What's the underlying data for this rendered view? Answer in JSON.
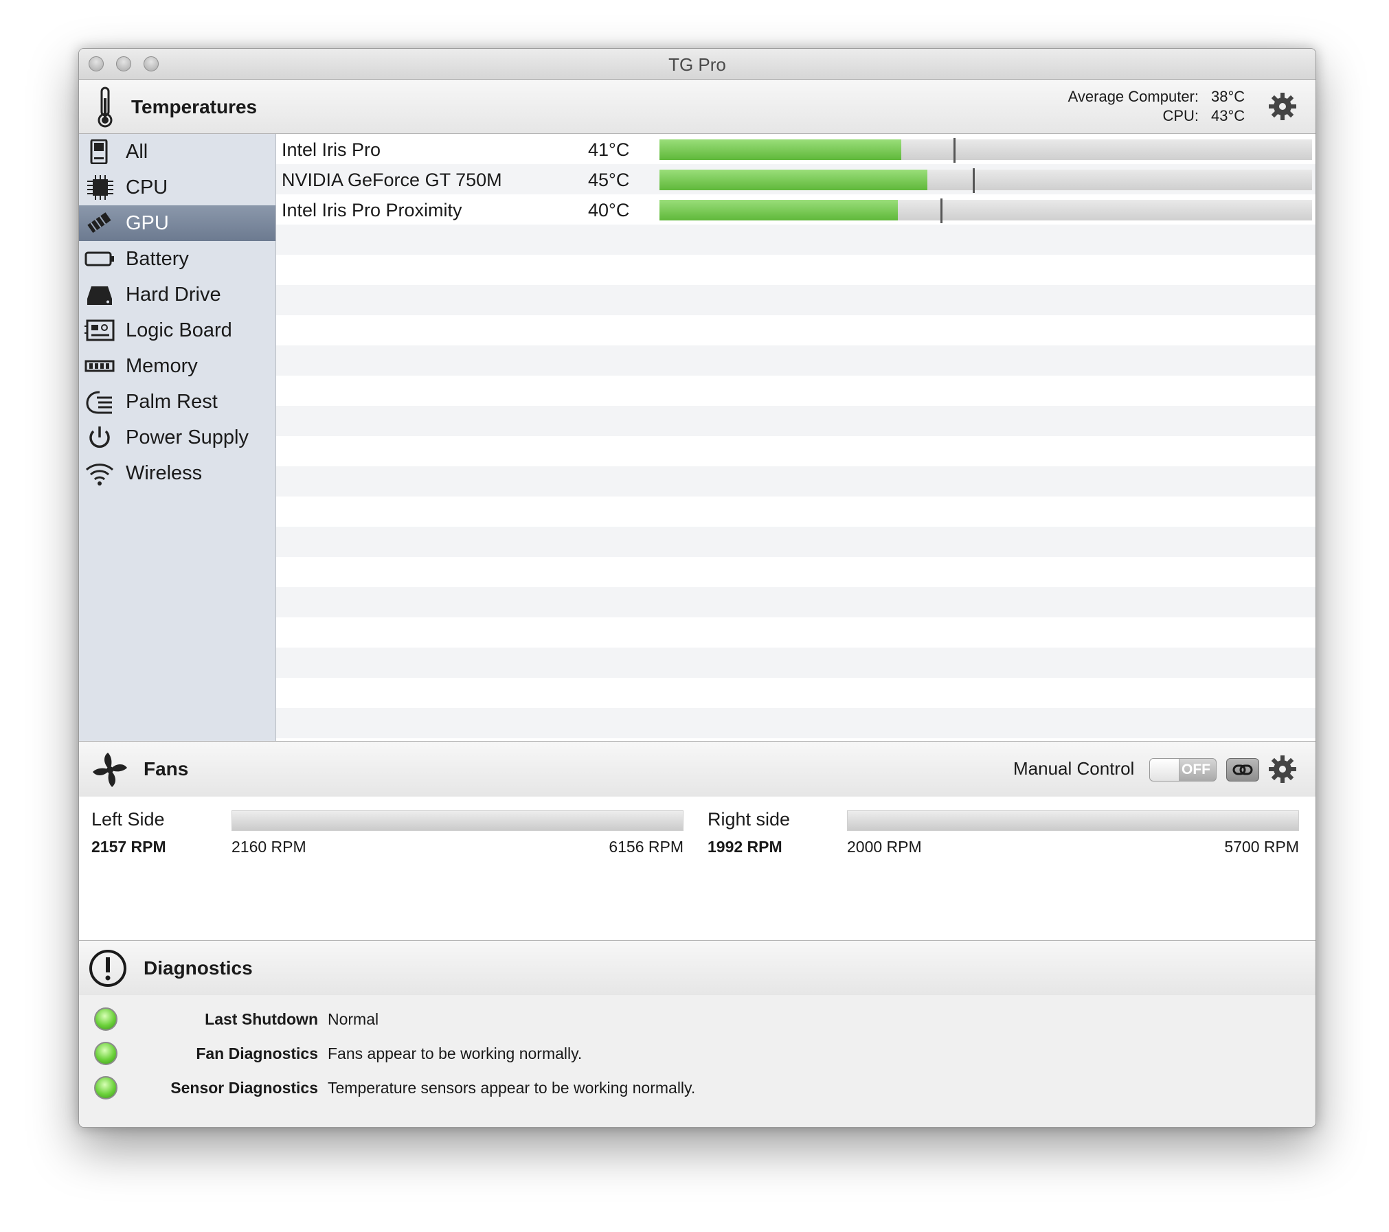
{
  "window": {
    "title": "TG Pro"
  },
  "temperatures": {
    "title": "Temperatures",
    "average_label": "Average Computer:",
    "average_value": "38°C",
    "cpu_label": "CPU:",
    "cpu_value": "43°C"
  },
  "sidebar": {
    "items": [
      {
        "label": "All",
        "icon": "computer-icon"
      },
      {
        "label": "CPU",
        "icon": "cpu-chip-icon"
      },
      {
        "label": "GPU",
        "icon": "gpu-card-icon",
        "selected": true
      },
      {
        "label": "Battery",
        "icon": "battery-icon"
      },
      {
        "label": "Hard Drive",
        "icon": "hard-drive-icon"
      },
      {
        "label": "Logic Board",
        "icon": "logic-board-icon"
      },
      {
        "label": "Memory",
        "icon": "memory-icon"
      },
      {
        "label": "Palm Rest",
        "icon": "palm-rest-icon"
      },
      {
        "label": "Power Supply",
        "icon": "power-icon"
      },
      {
        "label": "Wireless",
        "icon": "wifi-icon"
      }
    ]
  },
  "sensors": [
    {
      "name": "Intel Iris Pro",
      "value": "41°C",
      "fill": 0.37,
      "max_mark": 0.45
    },
    {
      "name": "NVIDIA GeForce GT 750M",
      "value": "45°C",
      "fill": 0.41,
      "max_mark": 0.48
    },
    {
      "name": "Intel Iris Pro Proximity",
      "value": "40°C",
      "fill": 0.365,
      "max_mark": 0.43
    }
  ],
  "fans": {
    "title": "Fans",
    "manual_control_label": "Manual Control",
    "toggle_state": "OFF",
    "items": [
      {
        "name": "Left Side",
        "rpm": "2157 RPM",
        "min": "2160 RPM",
        "max": "6156 RPM",
        "level": 0.0
      },
      {
        "name": "Right side",
        "rpm": "1992 RPM",
        "min": "2000 RPM",
        "max": "5700 RPM",
        "level": 0.0
      }
    ]
  },
  "diagnostics": {
    "title": "Diagnostics",
    "items": [
      {
        "label": "Last Shutdown",
        "value": "Normal",
        "status_color": "#6bd13a"
      },
      {
        "label": "Fan Diagnostics",
        "value": "Fans appear to be working normally.",
        "status_color": "#6bd13a"
      },
      {
        "label": "Sensor Diagnostics",
        "value": "Temperature sensors appear to be working normally.",
        "status_color": "#6bd13a"
      }
    ]
  },
  "colors": {
    "selection": "#7483a0",
    "bar_fill": "#6cc449",
    "sidebar_bg": "#dde2ea"
  }
}
